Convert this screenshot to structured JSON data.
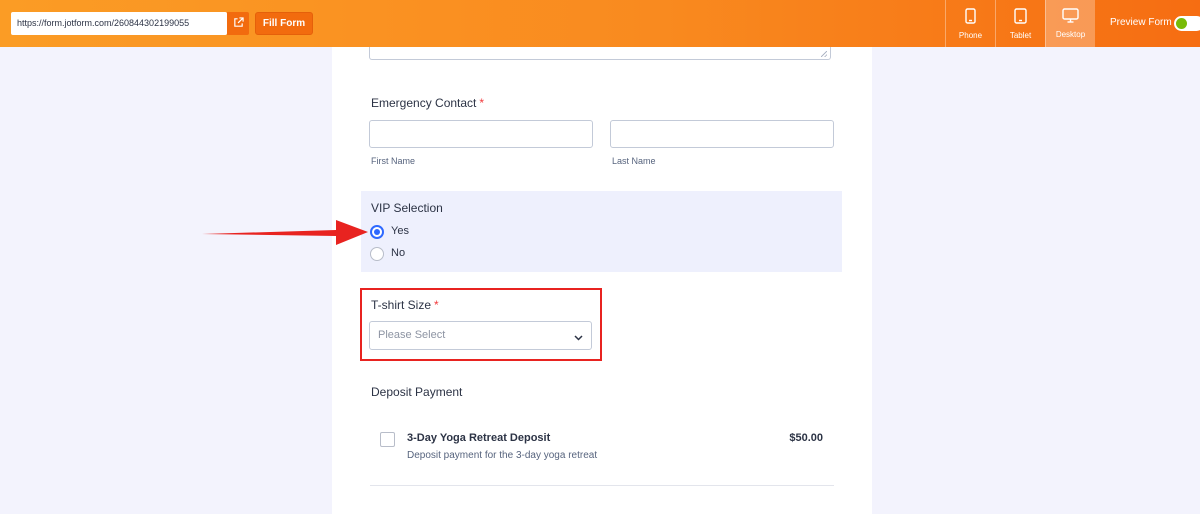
{
  "toolbar": {
    "url": "https://form.jotform.com/260844302199055",
    "fill_form_label": "Fill Form",
    "devices": [
      {
        "label": "Phone",
        "icon": "phone-icon",
        "active": false
      },
      {
        "label": "Tablet",
        "icon": "tablet-icon",
        "active": false
      },
      {
        "label": "Desktop",
        "icon": "desktop-icon",
        "active": true
      }
    ],
    "preview_label": "Preview Form",
    "preview_enabled": true,
    "accent_color": "#f98a1f",
    "toggle_color": "#78bb07"
  },
  "form": {
    "emergency_contact": {
      "label": "Emergency Contact",
      "required_mark": "*",
      "first_name_sublabel": "First Name",
      "last_name_sublabel": "Last Name",
      "first_name_value": "",
      "last_name_value": ""
    },
    "vip": {
      "label": "VIP Selection",
      "options": [
        {
          "label": "Yes",
          "selected": true
        },
        {
          "label": "No",
          "selected": false
        }
      ]
    },
    "tshirt": {
      "label": "T-shirt Size",
      "required_mark": "*",
      "placeholder": "Please Select"
    },
    "deposit": {
      "label": "Deposit Payment",
      "product_name": "3-Day Yoga Retreat Deposit",
      "product_description": "Deposit payment for the 3-day yoga retreat",
      "product_price": "$50.00",
      "product_checked": false
    }
  }
}
